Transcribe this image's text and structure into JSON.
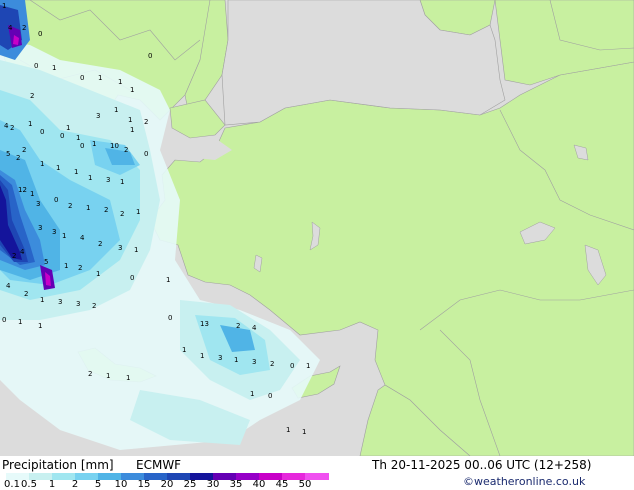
{
  "map": {
    "title": "Precipitation [mm]",
    "model": "ECMWF",
    "valid_time": "Th 20-11-2025 00..06 UTC (12+258)",
    "credit": "©weatheronline.co.uk",
    "colors": {
      "sea": "#dcdcdc",
      "land": "#c8f0a0",
      "borders": "#a0a0a0"
    },
    "legend": {
      "ticks": [
        "0.1",
        "0.5",
        "1",
        "2",
        "5",
        "10",
        "15",
        "20",
        "25",
        "30",
        "35",
        "40",
        "45",
        "50"
      ],
      "colors": [
        "#e6fafa",
        "#c8f0f0",
        "#a0e6f0",
        "#78d2f0",
        "#50b4e6",
        "#3c8cdc",
        "#2864c8",
        "#1e46b4",
        "#14149b",
        "#6400b4",
        "#9600c8",
        "#c800c8",
        "#e628dc",
        "#f050f0"
      ]
    },
    "value_labels": [
      "1",
      "4",
      "2",
      "0",
      "0",
      "1",
      "0",
      "1",
      "1",
      "2",
      "1",
      "0",
      "4",
      "2",
      "0",
      "1",
      "1",
      "0",
      "1",
      "3",
      "1",
      "1",
      "1",
      "2",
      "0",
      "1",
      "10",
      "2",
      "0",
      "5",
      "2",
      "2",
      "1",
      "1",
      "12",
      "1",
      "1",
      "3",
      "1",
      "1",
      "3",
      "0",
      "2",
      "1",
      "2",
      "2",
      "1",
      "3",
      "3",
      "1",
      "4",
      "2",
      "3",
      "1",
      "2",
      "4",
      "5",
      "1",
      "2",
      "1",
      "0",
      "1",
      "4",
      "2",
      "1",
      "3",
      "3",
      "2",
      "0",
      "1",
      "1",
      "0",
      "13",
      "2",
      "4",
      "1",
      "1",
      "3",
      "1",
      "3",
      "2",
      "0",
      "1",
      "2",
      "1",
      "1",
      "1",
      "0",
      "1",
      "1"
    ]
  }
}
